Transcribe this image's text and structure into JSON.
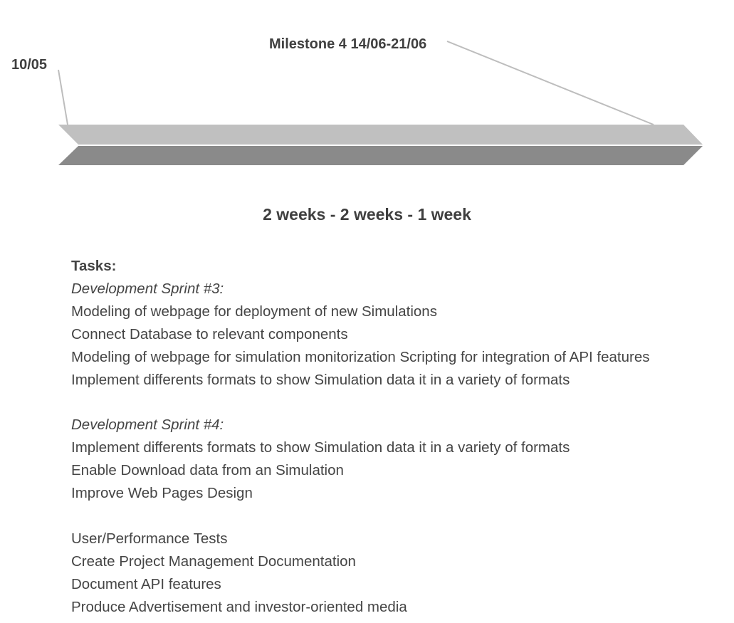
{
  "timeline": {
    "start_date": "10/05",
    "milestone": "Milestone 4 14/06-21/06",
    "duration": "2 weeks - 2 weeks - 1 week",
    "colors": {
      "bar_top": "#c0c0c0",
      "bar_bottom": "#8a8a8a",
      "connector": "#bdbdbd"
    }
  },
  "tasks": {
    "heading": "Tasks:",
    "sprint3": {
      "title": "Development Sprint #3:",
      "items": [
        "Modeling of webpage for deployment of new Simulations",
        "Connect Database to relevant components",
        "Modeling of webpage for simulation monitorization Scripting for integration of API features",
        "Implement differents formats to show Simulation data  it in a variety of formats"
      ]
    },
    "sprint4": {
      "title": "Development Sprint #4:",
      "items": [
        "Implement differents formats to show Simulation data  it in a variety of formats",
        "Enable Download data from an Simulation",
        "Improve Web Pages Design"
      ]
    },
    "other": {
      "items": [
        "User/Performance Tests",
        "Create Project Management Documentation",
        "Document API features",
        "Produce Advertisement and investor-oriented media"
      ]
    }
  }
}
